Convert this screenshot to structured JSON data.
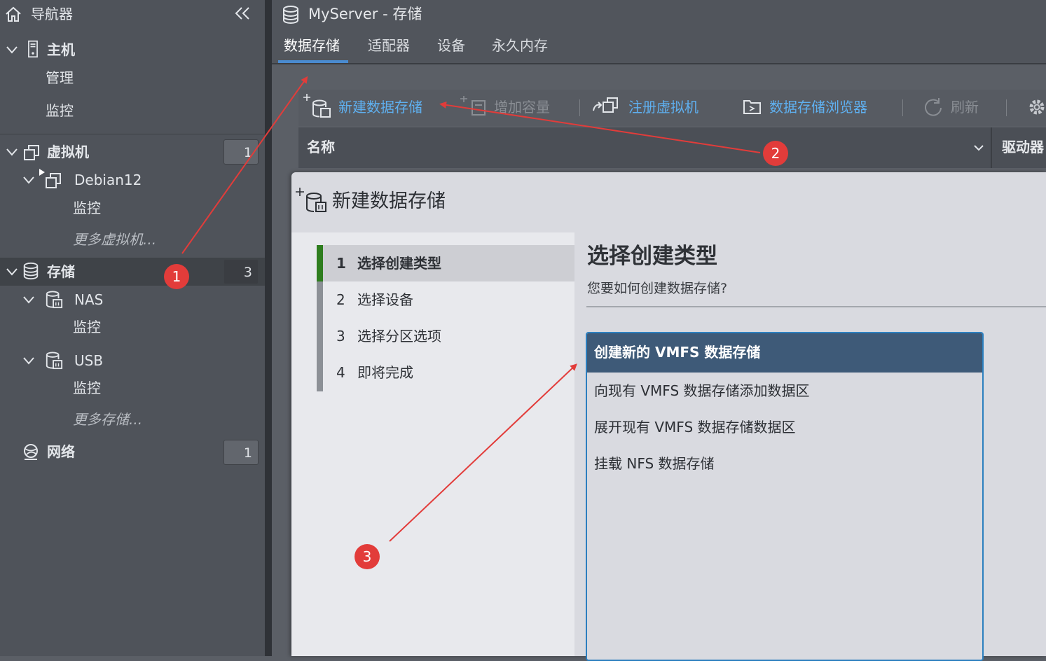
{
  "navigator": {
    "title": "导航器",
    "host": {
      "label": "主机",
      "items": [
        "管理",
        "监控"
      ]
    },
    "vms": {
      "label": "虚拟机",
      "count": "1",
      "vm": {
        "name": "Debian12",
        "monitor": "监控"
      },
      "more": "更多虚拟机..."
    },
    "storage": {
      "label": "存储",
      "count": "3",
      "datastores": [
        {
          "name": "NAS",
          "monitor": "监控"
        },
        {
          "name": "USB",
          "monitor": "监控"
        }
      ],
      "more": "更多存储..."
    },
    "network": {
      "label": "网络",
      "count": "1"
    }
  },
  "main": {
    "title": "MyServer - 存储",
    "tabs": [
      "数据存储",
      "适配器",
      "设备",
      "永久内存"
    ],
    "active_tab": "数据存储"
  },
  "toolbar": {
    "new_datastore": "新建数据存储",
    "increase_capacity": "增加容量",
    "register_vm": "注册虚拟机",
    "datastore_browser": "数据存储浏览器",
    "refresh": "刷新"
  },
  "table": {
    "col_name": "名称",
    "col_driver": "驱动器"
  },
  "dialog": {
    "title": "新建数据存储",
    "steps": [
      {
        "num": "1",
        "label": "选择创建类型"
      },
      {
        "num": "2",
        "label": "选择设备"
      },
      {
        "num": "3",
        "label": "选择分区选项"
      },
      {
        "num": "4",
        "label": "即将完成"
      }
    ],
    "active_step": 0,
    "heading": "选择创建类型",
    "question": "您要如何创建数据存储?",
    "options": [
      "创建新的 VMFS 数据存储",
      "向现有 VMFS 数据存储添加数据区",
      "展开现有 VMFS 数据存储数据区",
      "挂载 NFS 数据存储"
    ],
    "selected_option": 0
  },
  "annotations": {
    "badges": [
      "1",
      "2",
      "3"
    ],
    "color": "#e23c3a"
  },
  "colors": {
    "link_blue": "#5fb0f0",
    "selected_blue": "#3e5a78",
    "step_active_green": "#2e7d1e"
  }
}
